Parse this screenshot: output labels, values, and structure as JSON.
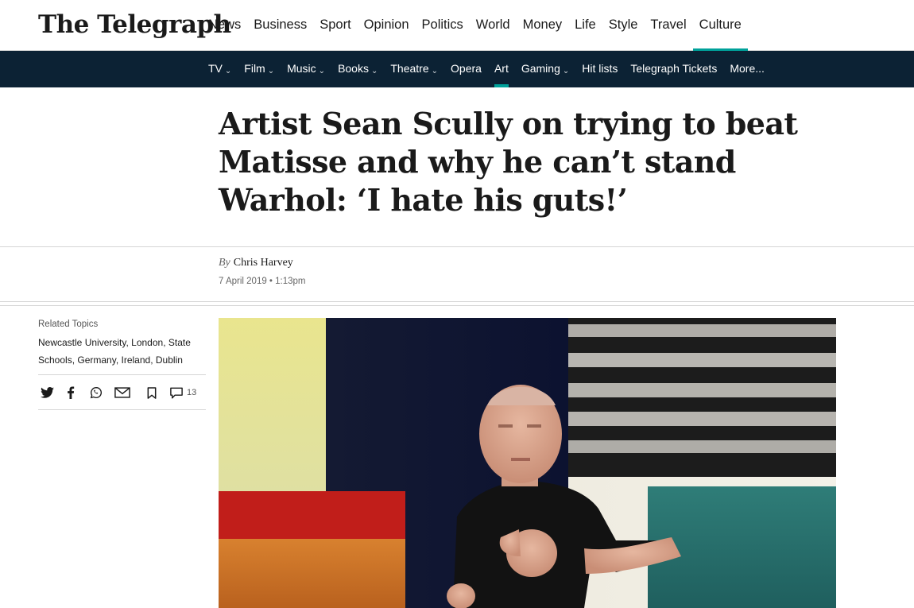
{
  "logo": {
    "text": "The Telegraph"
  },
  "main_nav": [
    {
      "label": "News",
      "active": false
    },
    {
      "label": "Business",
      "active": false
    },
    {
      "label": "Sport",
      "active": false
    },
    {
      "label": "Opinion",
      "active": false
    },
    {
      "label": "Politics",
      "active": false
    },
    {
      "label": "World",
      "active": false
    },
    {
      "label": "Money",
      "active": false
    },
    {
      "label": "Life",
      "active": false
    },
    {
      "label": "Style",
      "active": false
    },
    {
      "label": "Travel",
      "active": false
    },
    {
      "label": "Culture",
      "active": true
    }
  ],
  "sub_nav": [
    {
      "label": "TV",
      "dropdown": true
    },
    {
      "label": "Film",
      "dropdown": true
    },
    {
      "label": "Music",
      "dropdown": true
    },
    {
      "label": "Books",
      "dropdown": true
    },
    {
      "label": "Theatre",
      "dropdown": true
    },
    {
      "label": "Opera",
      "dropdown": false
    },
    {
      "label": "Art",
      "dropdown": false,
      "active": true
    },
    {
      "label": "Gaming",
      "dropdown": true
    },
    {
      "label": "Hit lists",
      "dropdown": false
    },
    {
      "label": "Telegraph Tickets",
      "dropdown": false
    },
    {
      "label": "More...",
      "dropdown": false
    }
  ],
  "article": {
    "headline": "Artist Sean Scully on trying to beat Matisse and why he can’t stand Warhol: ‘I hate his guts!’",
    "by_label": "By",
    "author": "Chris Harvey",
    "date": "7 April 2019 • 1:13pm"
  },
  "sidebar": {
    "related_label": "Related Topics",
    "topics": [
      "Newcastle University",
      "London",
      "State Schools",
      "Germany",
      "Ireland",
      "Dublin"
    ],
    "comment_count": "13"
  },
  "colors": {
    "accent": "#00a19a",
    "subnav_bg": "#0c2234",
    "text": "#1a1a1a"
  },
  "icons": [
    "twitter-icon",
    "facebook-icon",
    "whatsapp-icon",
    "email-icon",
    "bookmark-icon",
    "comment-icon",
    "chevron-down-icon"
  ]
}
